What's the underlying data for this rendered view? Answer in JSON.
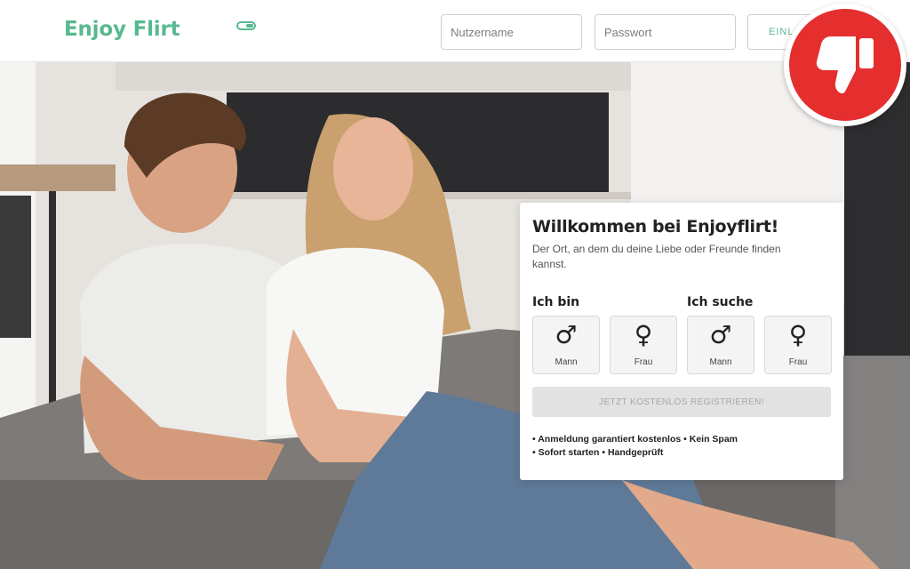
{
  "header": {
    "logo_text": "Enjoy Flirt",
    "username_placeholder": "Nutzername",
    "password_placeholder": "Passwort",
    "login_label": "EINLOGGEN"
  },
  "signup": {
    "title": "Willkommen bei Enjoyflirt!",
    "subtitle": "Der Ort, an dem du deine Liebe oder Freunde finden kannst.",
    "i_am_label": "Ich bin",
    "seeking_label": "Ich suche",
    "options": [
      {
        "label": "Mann",
        "icon": "male-symbol-icon"
      },
      {
        "label": "Frau",
        "icon": "female-symbol-icon"
      },
      {
        "label": "Mann",
        "icon": "male-symbol-icon"
      },
      {
        "label": "Frau",
        "icon": "female-symbol-icon"
      }
    ],
    "register_label": "JETZT KOSTENLOS REGISTRIEREN!",
    "features_line1": "• Anmeldung garantiert kostenlos • Kein Spam",
    "features_line2": "• Sofort starten • Handgeprüft"
  },
  "badge": {
    "icon": "thumbs-down-icon",
    "color": "#e52e2e"
  },
  "colors": {
    "brand": "#58b990",
    "badge_red": "#e52e2e"
  }
}
